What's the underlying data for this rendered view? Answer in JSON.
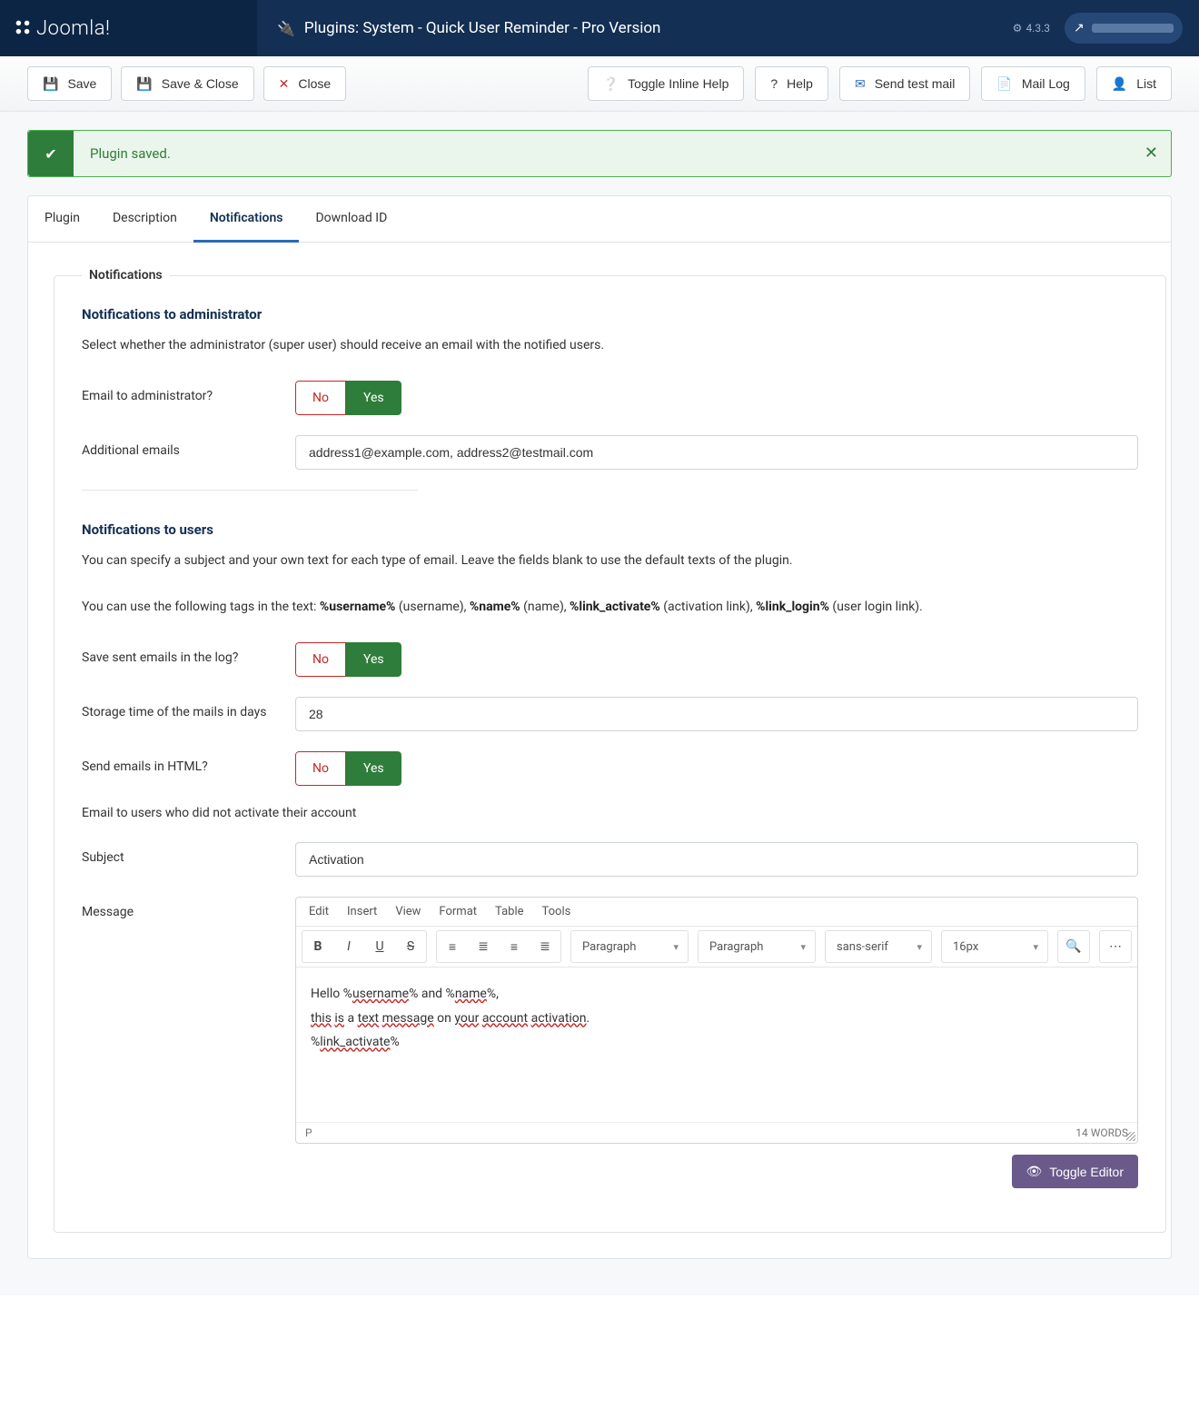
{
  "header": {
    "brand": "Joomla!",
    "title": "Plugins: System - Quick User Reminder - Pro Version",
    "version": "4.3.3"
  },
  "toolbar": {
    "save": "Save",
    "save_close": "Save & Close",
    "close": "Close",
    "toggle_help": "Toggle Inline Help",
    "help": "Help",
    "send_test": "Send test mail",
    "mail_log": "Mail Log",
    "list": "List"
  },
  "alert": {
    "text": "Plugin saved."
  },
  "tabs": [
    "Plugin",
    "Description",
    "Notifications",
    "Download ID"
  ],
  "active_tab": "Notifications",
  "fieldset_legend": "Notifications",
  "admin_section": {
    "title": "Notifications to administrator",
    "desc": "Select whether the administrator (super user) should receive an email with the notified users.",
    "email_label": "Email to administrator?",
    "no": "No",
    "yes": "Yes",
    "additional_label": "Additional emails",
    "additional_value": "address1@example.com, address2@testmail.com"
  },
  "user_section": {
    "title": "Notifications to users",
    "desc1": "You can specify a subject and your own text for each type of email. Leave the fields blank to use the default texts of the plugin.",
    "desc2_prefix": "You can use the following tags in the text: ",
    "tag1": "%username%",
    "tag1_note": " (username), ",
    "tag2": "%name%",
    "tag2_note": " (name), ",
    "tag3": "%link_activate%",
    "tag3_note": " (activation link), ",
    "tag4": "%link_login%",
    "tag4_note": " (user login link).",
    "save_log_label": "Save sent emails in the log?",
    "storage_label": "Storage time of the mails in days",
    "storage_value": "28",
    "html_label": "Send emails in HTML?",
    "no": "No",
    "yes": "Yes",
    "activate_note": "Email to users who did not activate their account",
    "subject_label": "Subject",
    "subject_value": "Activation",
    "message_label": "Message"
  },
  "editor": {
    "menubar": [
      "Edit",
      "Insert",
      "View",
      "Format",
      "Table",
      "Tools"
    ],
    "format1": "Paragraph",
    "format2": "Paragraph",
    "font": "sans-serif",
    "size": "16px",
    "body_line1_pre": "Hello %",
    "body_line1_u1": "username",
    "body_line1_mid": "% and %",
    "body_line1_u2": "name",
    "body_line1_post": "%,",
    "body_line2_w1": "this",
    "body_line2_w2": "is",
    "body_line2_t1": " a ",
    "body_line2_w3": "text",
    "body_line2_w4": "message",
    "body_line2_t2": " on ",
    "body_line2_w5": "your",
    "body_line2_w6": "account",
    "body_line2_w7": "activation",
    "body_line2_post": ".",
    "body_line3_pre": "%",
    "body_line3_u": "link_activate",
    "body_line3_post": "%",
    "status_path": "P",
    "status_words": "14 WORDS",
    "toggle_editor": "Toggle Editor"
  }
}
